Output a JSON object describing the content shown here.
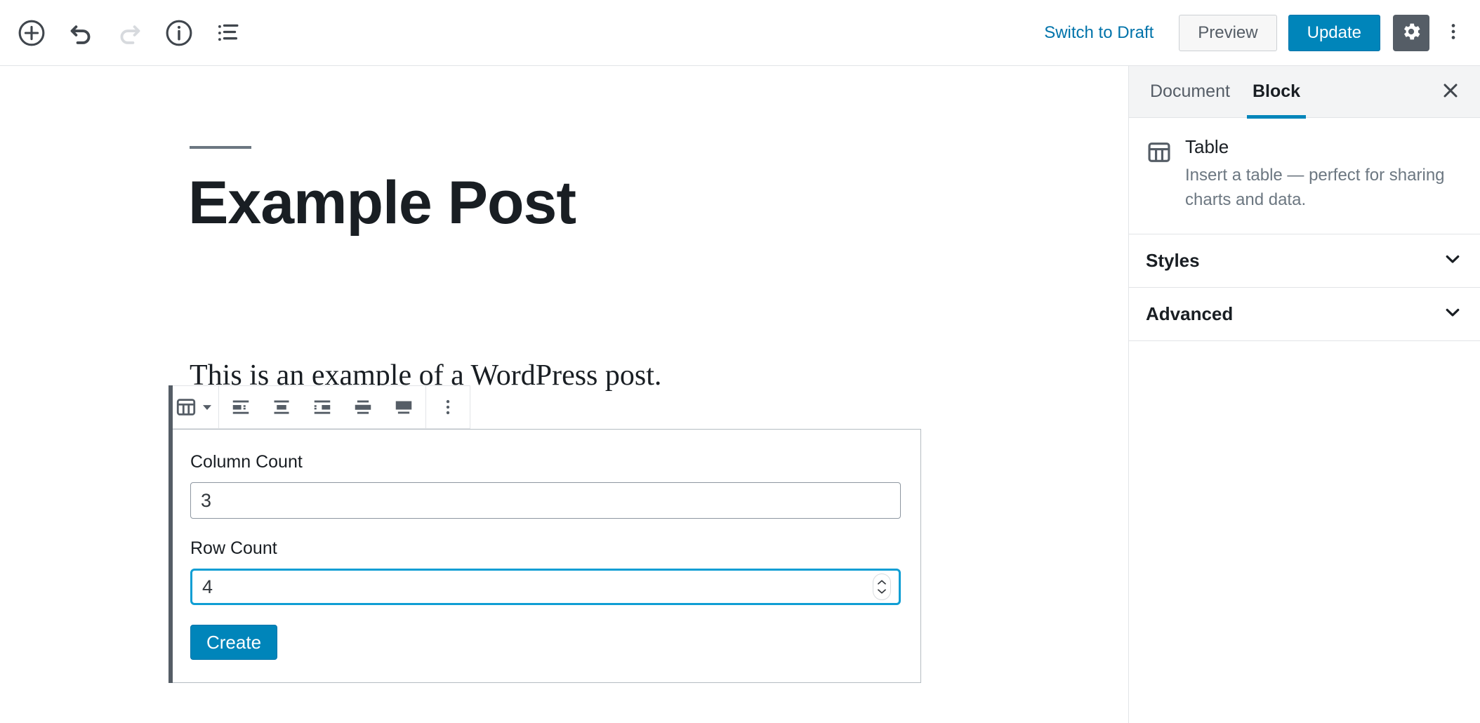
{
  "header": {
    "left_icons": [
      {
        "name": "add-block-icon",
        "label": "Add block"
      },
      {
        "name": "undo-icon",
        "label": "Undo"
      },
      {
        "name": "redo-icon",
        "label": "Redo"
      },
      {
        "name": "info-icon",
        "label": "Content structure"
      },
      {
        "name": "list-view-icon",
        "label": "Block navigation"
      }
    ],
    "switch_to_draft": "Switch to Draft",
    "preview": "Preview",
    "update": "Update",
    "settings_icon": "gear-icon",
    "more_icon": "ellipsis-vertical-icon"
  },
  "editor": {
    "title": "Example Post",
    "paragraph": "This is an example of a WordPress post."
  },
  "block_toolbar": {
    "block_type_icon": "table-icon",
    "dropdown_icon": "caret-down-icon",
    "alignments": [
      {
        "name": "align-left-icon",
        "label": "Align left"
      },
      {
        "name": "align-center-icon",
        "label": "Align center"
      },
      {
        "name": "align-right-icon",
        "label": "Align right"
      },
      {
        "name": "wide-width-icon",
        "label": "Wide width"
      },
      {
        "name": "full-width-icon",
        "label": "Full width"
      }
    ],
    "more_options_icon": "ellipsis-vertical-icon"
  },
  "table_placeholder": {
    "column_count_label": "Column Count",
    "column_count_value": "3",
    "row_count_label": "Row Count",
    "row_count_value": "4",
    "create_label": "Create"
  },
  "sidebar": {
    "tabs": [
      {
        "label": "Document",
        "active": false
      },
      {
        "label": "Block",
        "active": true
      }
    ],
    "close_icon": "close-icon",
    "block": {
      "icon": "table-icon",
      "title": "Table",
      "description": "Insert a table — perfect for sharing charts and data."
    },
    "panels": [
      {
        "title": "Styles",
        "icon": "chevron-down-icon"
      },
      {
        "title": "Advanced",
        "icon": "chevron-down-icon"
      }
    ]
  },
  "colors": {
    "accent_blue": "#0085ba",
    "link_blue": "#0073aa",
    "focus_blue": "#0f9ed4",
    "icon_gray": "#555d66",
    "border_gray": "#e2e4e7",
    "text_dark": "#191e23",
    "text_muted": "#6c7781"
  }
}
